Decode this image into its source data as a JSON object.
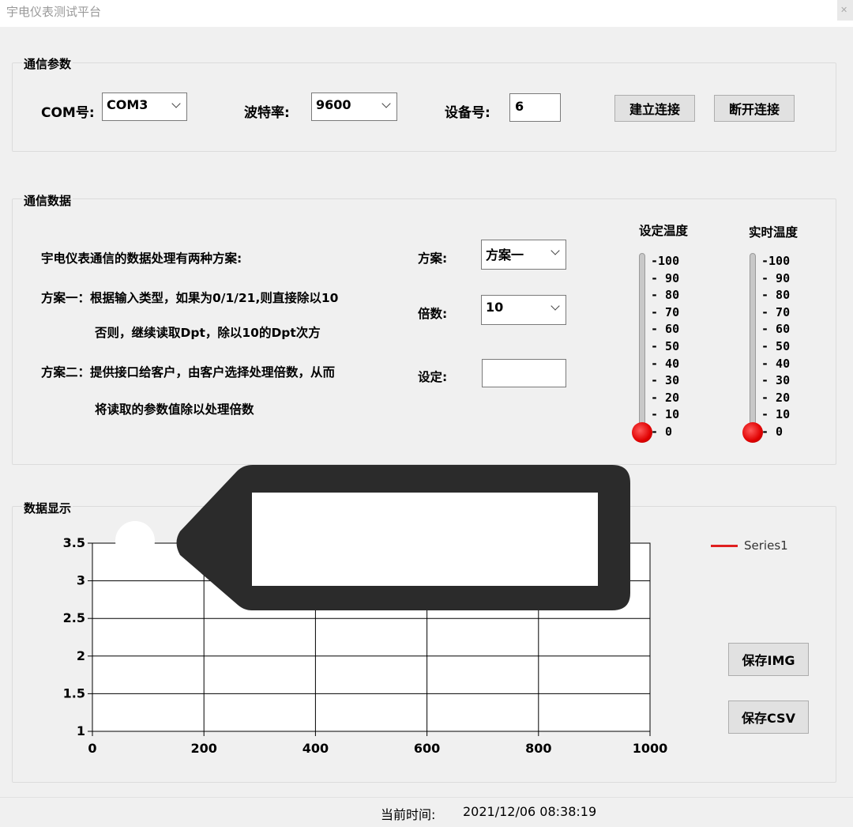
{
  "window": {
    "title": "宇电仪表测试平台"
  },
  "comm_params": {
    "group_title": "通信参数",
    "com_label": "COM号:",
    "com_value": "COM3",
    "baud_label": "波特率:",
    "baud_value": "9600",
    "device_label": "设备号:",
    "device_value": "6",
    "connect_button": "建立连接",
    "disconnect_button": "断开连接"
  },
  "comm_data": {
    "group_title": "通信数据",
    "desc_line1": "宇电仪表通信的数据处理有两种方案:",
    "desc_line2": "方案一：根据输入类型，如果为0/1/21,则直接除以10",
    "desc_line3": "否则，继续读取Dpt，除以10的Dpt次方",
    "desc_line4": "方案二：提供接口给客户，由客户选择处理倍数，从而",
    "desc_line5": "将读取的参数值除以处理倍数",
    "scheme_label": "方案:",
    "scheme_value": "方案一",
    "multiplier_label": "倍数:",
    "multiplier_value": "10",
    "set_label": "设定:",
    "set_value": ""
  },
  "thermometers": {
    "set_temp_title": "设定温度",
    "real_temp_title": "实时温度",
    "ticks": [
      "100",
      "90",
      "80",
      "70",
      "60",
      "50",
      "40",
      "30",
      "20",
      "10",
      "0"
    ],
    "set_temp_value": 0,
    "real_temp_value": 0
  },
  "data_display": {
    "group_title": "数据显示",
    "save_img_button": "保存IMG",
    "save_csv_button": "保存CSV"
  },
  "chart_data": {
    "type": "line",
    "series": [
      {
        "name": "Series1",
        "color": "#e02020",
        "x": [],
        "y": []
      }
    ],
    "xlim": [
      0,
      1000
    ],
    "ylim": [
      1,
      3.5
    ],
    "xticks": [
      "0",
      "200",
      "400",
      "600",
      "800",
      "1000"
    ],
    "yticks": [
      "1",
      "1.5",
      "2",
      "2.5",
      "3",
      "3.5"
    ],
    "grid": true,
    "legend": "top-right"
  },
  "status_bar": {
    "time_label": "当前时间:",
    "time_value": "2021/12/06 08:38:19"
  }
}
